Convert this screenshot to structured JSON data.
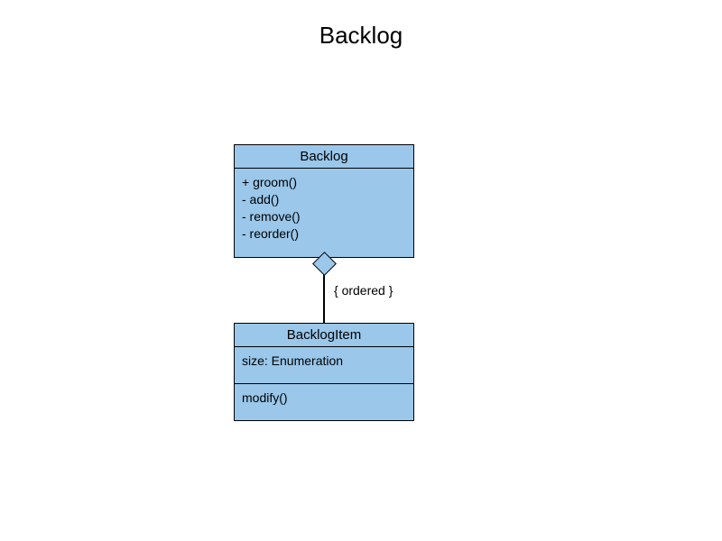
{
  "title": "Backlog",
  "connector": {
    "constraint": "{ ordered }",
    "end_decoration": "aggregation-diamond"
  },
  "classes": {
    "backlog": {
      "name": "Backlog",
      "operations": [
        "+ groom()",
        "- add()",
        "- remove()",
        "- reorder()"
      ]
    },
    "backlogItem": {
      "name": "BacklogItem",
      "attributes": [
        "size: Enumeration"
      ],
      "operations": [
        "modify()"
      ]
    }
  }
}
